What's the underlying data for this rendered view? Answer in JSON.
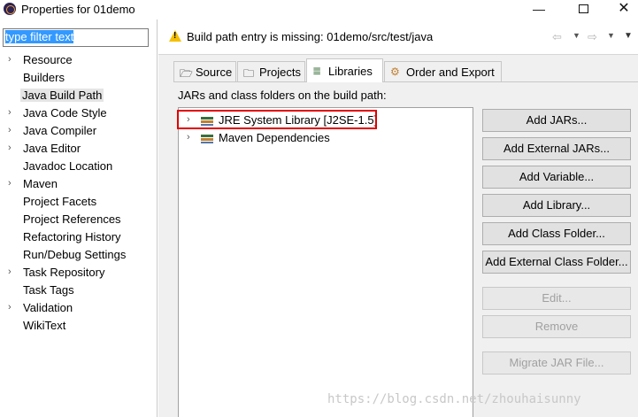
{
  "window": {
    "title": "Properties for 01demo",
    "min_glyph": "—",
    "close_glyph": "✕"
  },
  "filter": {
    "value": "type filter text"
  },
  "nav_tree": [
    {
      "label": "Resource",
      "expandable": true
    },
    {
      "label": "Builders",
      "expandable": false
    },
    {
      "label": "Java Build Path",
      "expandable": false,
      "selected": true
    },
    {
      "label": "Java Code Style",
      "expandable": true
    },
    {
      "label": "Java Compiler",
      "expandable": true
    },
    {
      "label": "Java Editor",
      "expandable": true
    },
    {
      "label": "Javadoc Location",
      "expandable": false
    },
    {
      "label": "Maven",
      "expandable": true
    },
    {
      "label": "Project Facets",
      "expandable": false
    },
    {
      "label": "Project References",
      "expandable": false
    },
    {
      "label": "Refactoring History",
      "expandable": false
    },
    {
      "label": "Run/Debug Settings",
      "expandable": false
    },
    {
      "label": "Task Repository",
      "expandable": true
    },
    {
      "label": "Task Tags",
      "expandable": false
    },
    {
      "label": "Validation",
      "expandable": true
    },
    {
      "label": "WikiText",
      "expandable": false
    }
  ],
  "header": {
    "message": "Build path entry is missing: 01demo/src/test/java",
    "icon": "warning-icon"
  },
  "tabs": {
    "source": "Source",
    "projects": "Projects",
    "libraries": "Libraries",
    "order": "Order and Export",
    "active": "libraries"
  },
  "libraries": {
    "section_label": "JARs and class folders on the build path:",
    "entries": [
      {
        "label": "JRE System Library [J2SE-1.5]",
        "highlighted": true
      },
      {
        "label": "Maven Dependencies",
        "highlighted": false
      }
    ]
  },
  "buttons": {
    "add_jars": "Add JARs...",
    "add_external_jars": "Add External JARs...",
    "add_variable": "Add Variable...",
    "add_library": "Add Library...",
    "add_class_folder": "Add Class Folder...",
    "add_external_class_folder": "Add External Class Folder...",
    "edit": "Edit...",
    "remove": "Remove",
    "migrate_jar": "Migrate JAR File..."
  },
  "watermark": "https://blog.csdn.net/zhouhaisunny",
  "colors": {
    "highlight_box": "#e00000",
    "selection": "#3399ff",
    "warning": "#f5c000"
  }
}
